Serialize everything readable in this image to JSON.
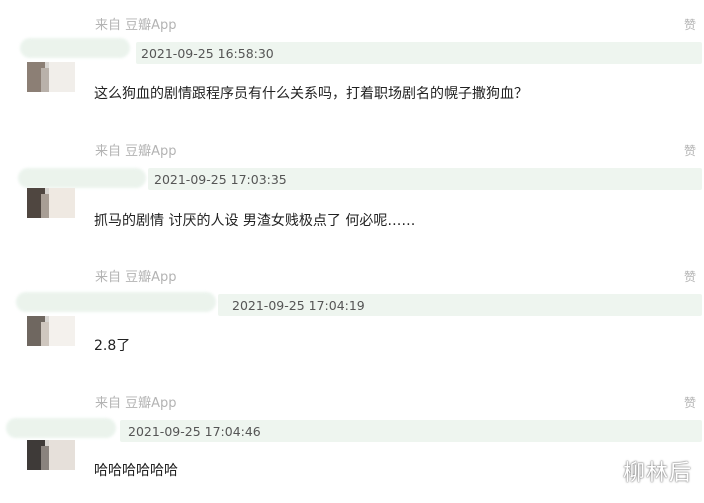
{
  "comments": [
    {
      "source": "来自 豆瓣App",
      "like_label": "赞",
      "timestamp": "2021-09-25 16:58:30",
      "text": "这么狗血的剧情跟程序员有什么关系吗，打着职场剧名的幌子撒狗血？"
    },
    {
      "source": "来自 豆瓣App",
      "like_label": "赞",
      "timestamp": "2021-09-25 17:03:35",
      "text": "抓马的剧情 讨厌的人设 男渣女贱极点了 何必呢……"
    },
    {
      "source": "来自 豆瓣App",
      "like_label": "赞",
      "timestamp": "2021-09-25 17:04:19",
      "text": "2.8了"
    },
    {
      "source": "来自 豆瓣App",
      "like_label": "赞",
      "timestamp": "2021-09-25 17:04:46",
      "text": "哈哈哈哈哈哈"
    }
  ],
  "watermark": "柳林后"
}
